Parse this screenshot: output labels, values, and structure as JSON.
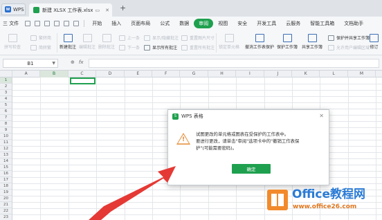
{
  "tabs": {
    "wps_label": "WPS",
    "doc_title": "新建 XLSX 工作表.xlsx",
    "add": "+"
  },
  "menu": {
    "file": "三 文件",
    "items": [
      "开始",
      "插入",
      "页面布局",
      "公式",
      "数据",
      "审阅",
      "视图",
      "安全",
      "开发工具",
      "云服务",
      "智能工具箱",
      "文档助手"
    ],
    "active_index": 5
  },
  "ribbon": {
    "spell_check": "拼写检查",
    "trad_simp_1": "繁转简",
    "trad_simp_2": "简转繁",
    "new_comment": "新建批注",
    "edit_comment": "编辑批注",
    "delete_comment": "删除批注",
    "prev": "上一条",
    "next": "下一条",
    "show_hide_comment": "显示/隐藏批注",
    "show_all_comments": "显示所有批注",
    "reset_pic_size": "重置图片尺寸",
    "reset_pic_comment": "重置所有批注",
    "lock_cell": "锁定单元格",
    "unprotect_sheet": "撤消工作表保护",
    "protect_workbook": "保护工作簿",
    "share_workbook": "共享工作簿",
    "protect_share": "保护并共享工作簿",
    "allow_edit": "允许用户编辑区域",
    "revise": "修订"
  },
  "formula_bar": {
    "cell_ref": "B1",
    "icons": [
      "zoom-icon",
      "fx-icon"
    ]
  },
  "grid": {
    "columns": [
      "A",
      "B",
      "C",
      "D",
      "E",
      "F",
      "G",
      "H",
      "I",
      "J",
      "K",
      "L",
      "M"
    ],
    "selected_column": "B",
    "rows": [
      "1",
      "2",
      "3",
      "4",
      "5",
      "6",
      "7",
      "8",
      "9",
      "10",
      "11",
      "12",
      "13",
      "14",
      "15",
      "16",
      "17",
      "18",
      "19",
      "20",
      "21",
      "22",
      "23"
    ],
    "selected_row": "1"
  },
  "dialog": {
    "title": "WPS 表格",
    "message_line1": "试图更改的单元格或图表在受保护的工作表中。",
    "message_line2": "要进行更改，请单击\"审阅\"选项卡中的\"撤销工作表保",
    "message_line3": "护\"(可能需要密码)。",
    "ok_label": "确定"
  },
  "watermark": {
    "brand": "Office教程网",
    "url": "www.office26.com"
  },
  "colors": {
    "accent": "#1fa04f",
    "warning": "#e69443",
    "arrow": "#e53935"
  }
}
